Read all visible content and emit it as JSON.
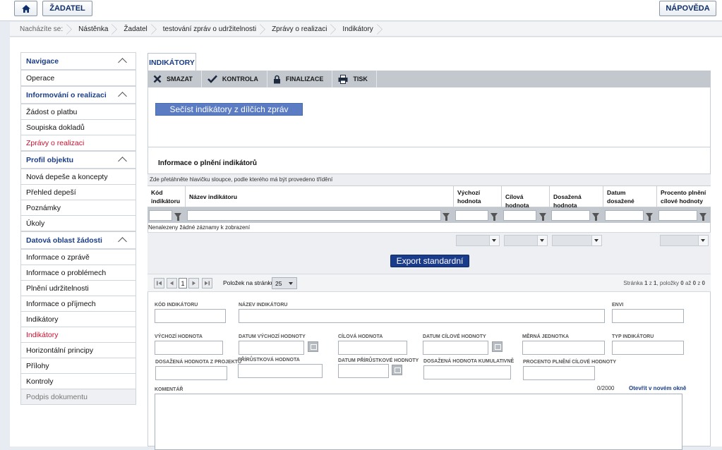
{
  "header": {
    "home_icon": "home-icon",
    "zadatel_label": "ŽADATEL",
    "napoveda_label": "NÁPOVĚDA"
  },
  "breadcrumb": {
    "prefix": "Nacházíte se:",
    "items": [
      "Nástěnka",
      "Žadatel",
      "testování zpráv o udržitelnosti",
      "Zprávy o realizaci",
      "Indikátory"
    ]
  },
  "sidebar": {
    "sections": [
      {
        "title": "Navigace",
        "items": [
          "Operace"
        ]
      },
      {
        "title": "Informování o realizaci",
        "items": [
          "Žádost o platbu",
          "Soupiska dokladů",
          "Zprávy o realizaci"
        ]
      },
      {
        "title": "Profil objektu",
        "items": [
          "Nová depeše a koncepty",
          "Přehled depeší",
          "Poznámky",
          "Úkoly"
        ]
      },
      {
        "title": "Datová oblast žádosti",
        "items": [
          "Informace o zprávě",
          "Informace o problémech",
          "Plnění udržitelnosti",
          "Informace o příjmech",
          "Indikátory",
          "Indikátory",
          "Horizontální principy",
          "Přílohy",
          "Kontroly",
          "Podpis dokumentu"
        ]
      }
    ]
  },
  "main": {
    "tab_label": "INDIKÁTORY",
    "toolbar": {
      "smazat": "SMAZAT",
      "kontrola": "KONTROLA",
      "finalizace": "FINALIZACE",
      "tisk": "TISK"
    },
    "secist_button": "Sečíst indikátory z dílčích zpráv",
    "section_title": "Informace o plnění indikátorů",
    "grid_hint": "Zde přetáhněte hlavičku sloupce, podle kterého má být provedeno třídění",
    "columns": [
      "Kód indikátoru",
      "Název indikátoru",
      "Výchozí hodnota",
      "Cílová hodnota",
      "Dosažená hodnota",
      "Datum dosažené hodnoty",
      "Procento plnění cílové hodnoty"
    ],
    "empty_text": "Nenalezeny žádné záznamy k zobrazení",
    "export_button": "Export standardní",
    "pager": {
      "page": "1",
      "per_page_label": "Položek na stránku",
      "per_page_value": "25",
      "summary_prefix": "Stránka",
      "summary_page": "1",
      "summary_of": "z",
      "summary_total_pages": "1",
      "summary_items": ", položky",
      "summary_from": "0",
      "summary_to_word": "až",
      "summary_to": "0",
      "summary_z": "z",
      "summary_count": "0"
    },
    "form": {
      "kod_label": "KÓD INDIKÁTORU",
      "nazev_label": "NÁZEV INDIKÁTORU",
      "envi_label": "ENVI",
      "vychozi_label": "VÝCHOZÍ HODNOTA",
      "datum_vychozi_label": "DATUM VÝCHOZÍ HODNOTY",
      "cilova_label": "CÍLOVÁ HODNOTA",
      "datum_cilove_label": "DATUM CÍLOVÉ HODNOTY",
      "merna_label": "MĚRNÁ JEDNOTKA",
      "typ_label": "TYP INDIKÁTORU",
      "dosazena_label": "DOSAŽENÁ HODNOTA Z PROJEKTU",
      "prirustkova_label": "PŘÍRŮSTKOVÁ HODNOTA",
      "datum_prirustkove_label": "DATUM PŘÍRŮSTKOVÉ HODNOTY",
      "dosazena_kum_label": "DOSAŽENÁ HODNOTA KUMULATIVNĚ",
      "procento_label": "PROCENTO PLNĚNÍ CÍLOVÉ HODNOTY",
      "komentar_label": "KOMENTÁŘ",
      "komentar_counter": "0/2000",
      "otevrit_link": "Otevřít v novém okně"
    }
  }
}
